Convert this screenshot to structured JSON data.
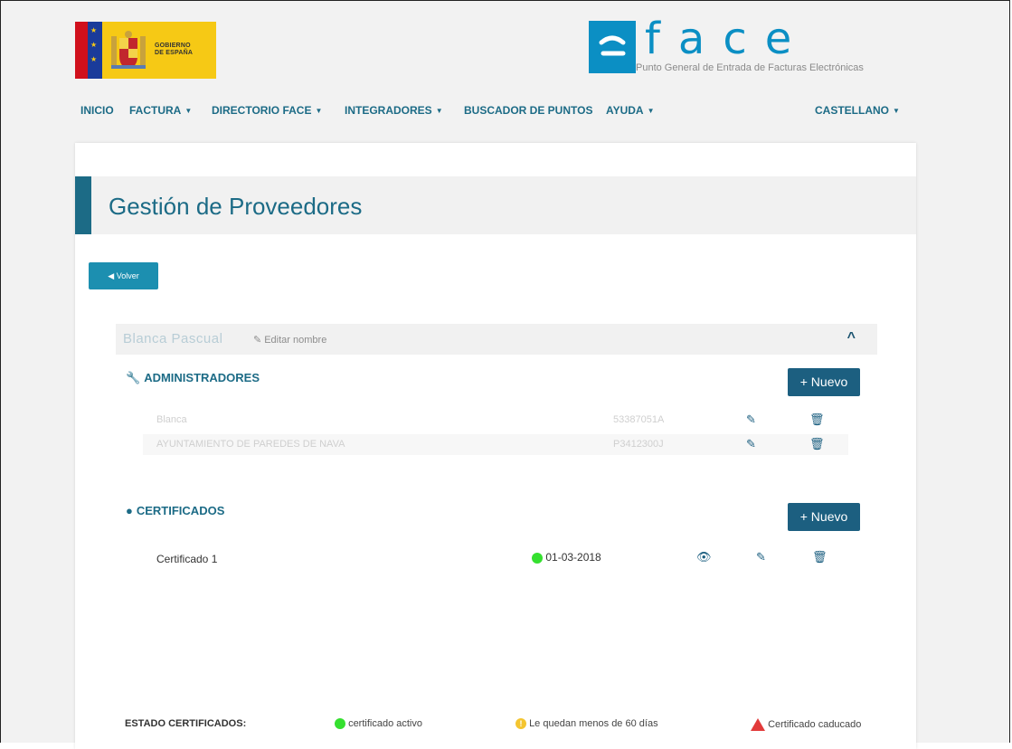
{
  "header": {
    "gov_logo_text": [
      "GOBIERNO",
      "DE ESPAÑA"
    ],
    "face_logo": {
      "letters": "face",
      "tagline": "Punto General de Entrada de Facturas Electrónicas"
    }
  },
  "nav": {
    "items": [
      {
        "label": "INICIO",
        "has_caret": false
      },
      {
        "label": "FACTURA",
        "has_caret": true
      },
      {
        "label": "DIRECTORIO FACE",
        "has_caret": true
      },
      {
        "label": "INTEGRADORES",
        "has_caret": true
      },
      {
        "label": "BUSCADOR DE PUNTOS",
        "has_caret": false
      },
      {
        "label": "AYUDA",
        "has_caret": true
      }
    ],
    "language": "CASTELLANO"
  },
  "page": {
    "title": "Gestión de Proveedores",
    "back_label": "Volver"
  },
  "provider": {
    "name": "Blanca Pascual",
    "edit_label": "Editar nombre"
  },
  "administradores": {
    "heading": "ADMINISTRADORES",
    "new_label": "Nuevo",
    "rows": [
      {
        "name": "Blanca",
        "id": "53387051A"
      },
      {
        "name": "AYUNTAMIENTO DE PAREDES DE NAVA",
        "id": "P3412300J"
      }
    ]
  },
  "certificados": {
    "heading": "CERTIFICADOS",
    "new_label": "Nuevo",
    "rows": [
      {
        "name": "Certificado 1",
        "date": "01-03-2018",
        "status": "active"
      }
    ]
  },
  "legend": {
    "label": "ESTADO CERTIFICADOS:",
    "active": "certificado activo",
    "warning": "Le quedan menos de 60 días",
    "expired": "Certificado caducado"
  },
  "colors": {
    "primary": "#1c6b86",
    "button": "#1c5f80",
    "active": "#35e02f",
    "warning": "#f4c530",
    "expired": "#e23a3a"
  }
}
